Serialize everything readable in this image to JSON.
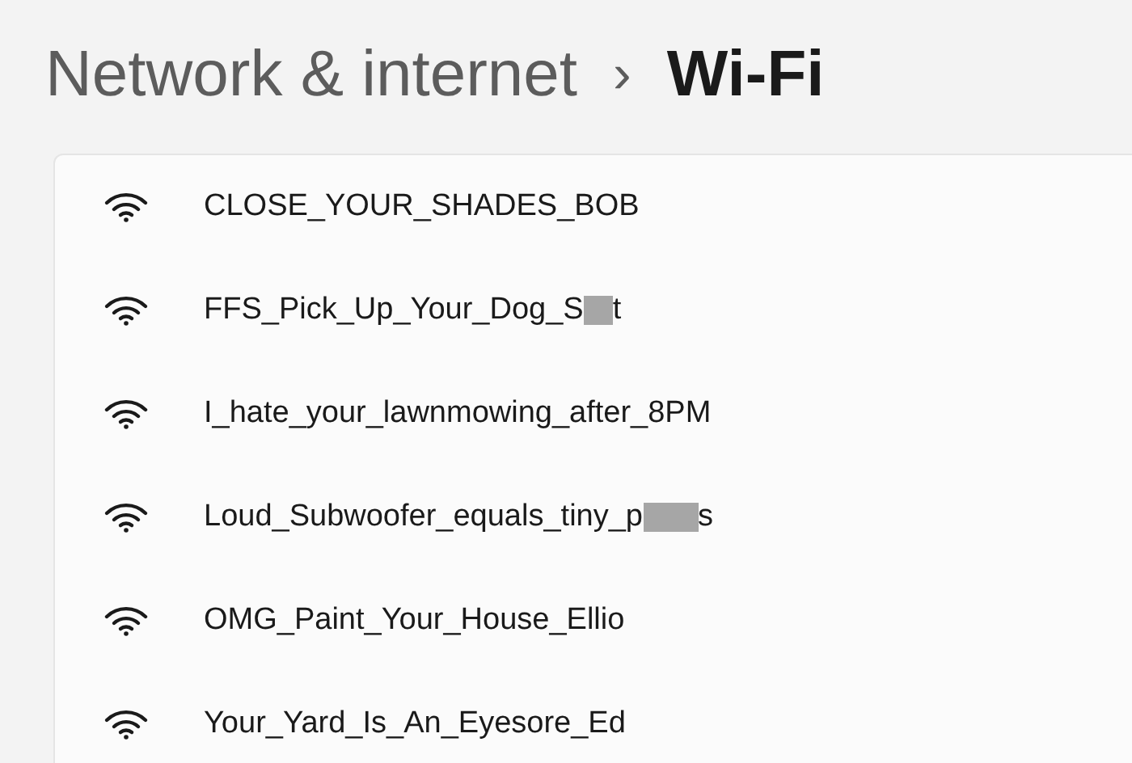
{
  "breadcrumb": {
    "parent": "Network & internet",
    "separator": "›",
    "current": "Wi-Fi"
  },
  "networks": [
    {
      "segments": [
        {
          "kind": "text",
          "text": "CLOSE_YOUR_SHADES_BOB"
        }
      ]
    },
    {
      "segments": [
        {
          "kind": "text",
          "text": "FFS_Pick_Up_Your_Dog_S"
        },
        {
          "kind": "redaction_short"
        },
        {
          "kind": "text",
          "text": "t"
        }
      ]
    },
    {
      "segments": [
        {
          "kind": "text",
          "text": "I_hate_your_lawnmowing_after_8PM"
        }
      ]
    },
    {
      "segments": [
        {
          "kind": "text",
          "text": "Loud_Subwoofer_equals_tiny_p"
        },
        {
          "kind": "redaction_long"
        },
        {
          "kind": "text",
          "text": "s"
        }
      ]
    },
    {
      "segments": [
        {
          "kind": "text",
          "text": "OMG_Paint_Your_House_Ellio"
        }
      ]
    },
    {
      "segments": [
        {
          "kind": "text",
          "text": "Your_Yard_Is_An_Eyesore_Ed"
        }
      ]
    }
  ]
}
